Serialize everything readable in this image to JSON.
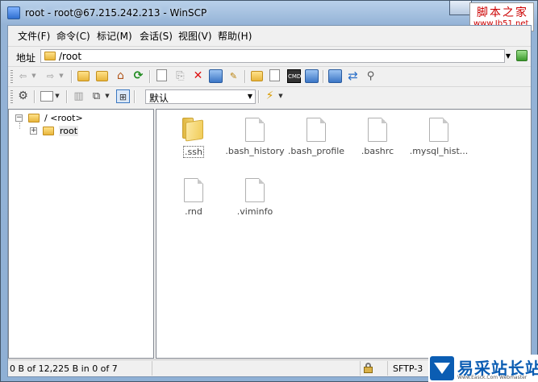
{
  "window": {
    "title": "root - root@67.215.242.213 - WinSCP"
  },
  "watermark_top": {
    "line1": "脚本之家",
    "line2": "www.Jb51.net"
  },
  "menu": [
    {
      "label": "文件(F)"
    },
    {
      "label": "命令(C)"
    },
    {
      "label": "标记(M)"
    },
    {
      "label": "会话(S)"
    },
    {
      "label": "视图(V)"
    },
    {
      "label": "帮助(H)"
    }
  ],
  "address": {
    "label": "地址",
    "path": "/root"
  },
  "toolbar": {
    "session_select": "默认"
  },
  "tree": {
    "root_label": "/ <root>",
    "child_label": "root"
  },
  "files": [
    {
      "name": ".ssh",
      "type": "folder",
      "selected": true
    },
    {
      "name": ".bash_history",
      "type": "file"
    },
    {
      "name": ".bash_profile",
      "type": "file"
    },
    {
      "name": ".bashrc",
      "type": "file"
    },
    {
      "name": ".mysql_hist...",
      "type": "file"
    },
    {
      "name": ".rnd",
      "type": "file"
    },
    {
      "name": ".viminfo",
      "type": "file"
    }
  ],
  "status": {
    "summary": "0 B of 12,225 B in 0 of 7",
    "protocol": "SFTP-3"
  },
  "watermark_bottom": {
    "text": "易采站长站",
    "sub": "Www.Easck.Com Webmaster"
  }
}
